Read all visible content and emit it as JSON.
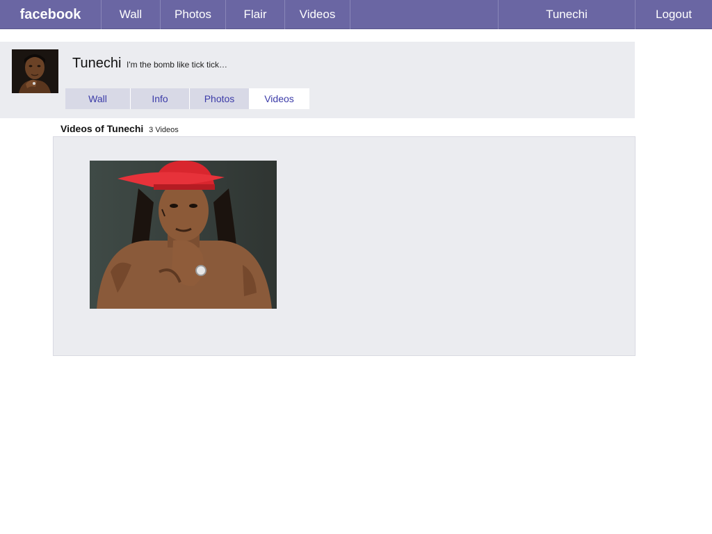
{
  "topbar": {
    "brand": "facebook",
    "nav": {
      "wall": "Wall",
      "photos": "Photos",
      "flair": "Flair",
      "videos": "Videos"
    },
    "user": "Tunechi",
    "logout": "Logout",
    "bar_color": "#6a66a3"
  },
  "profile": {
    "name": "Tunechi",
    "status": "I'm the bomb like tick tick…",
    "tabs": {
      "wall": "Wall",
      "info": "Info",
      "photos": "Photos",
      "videos": "Videos"
    },
    "active_tab": "Videos"
  },
  "videos": {
    "title": "Videos of Tunechi",
    "count": "3 Videos"
  }
}
